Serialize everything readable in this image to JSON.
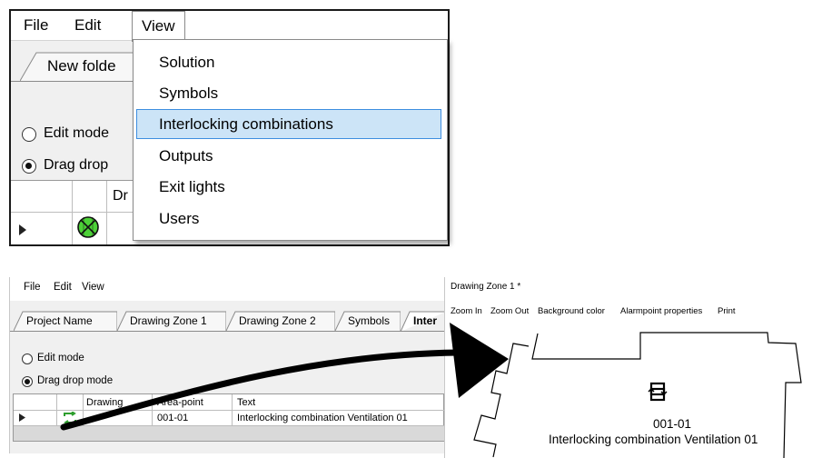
{
  "top": {
    "menu": {
      "file": "File",
      "edit": "Edit",
      "view": "View"
    },
    "tab_label": "New folde",
    "radio_edit": "Edit mode",
    "radio_drag": "Drag drop",
    "grid_header_partial": "Dr",
    "dropdown": {
      "items": [
        "Solution",
        "Symbols",
        "Interlocking combinations",
        "Outputs",
        "Exit lights",
        "Users"
      ],
      "highlighted": "Interlocking combinations",
      "highlight_color": "#cce4f7"
    }
  },
  "bottom_left": {
    "menu": {
      "file": "File",
      "edit": "Edit",
      "view": "View"
    },
    "tabs": [
      "Project Name",
      "Drawing Zone 1",
      "Drawing Zone 2",
      "Symbols",
      "Inter"
    ],
    "radio_edit": "Edit mode",
    "radio_drag": "Drag drop mode",
    "grid": {
      "headers": [
        "Drawing",
        "Area-point",
        "Text"
      ],
      "row": {
        "area_point": "001-01",
        "text": "Interlocking combination Ventilation 01"
      }
    }
  },
  "bottom_right": {
    "title": "Drawing Zone 1 *",
    "toolbar": [
      "Zoom In",
      "Zoom Out",
      "Background color",
      "Alarmpoint properties",
      "Print"
    ],
    "symbol": {
      "area_code": "001-01",
      "text": "Interlocking combination Ventilation 01"
    }
  }
}
